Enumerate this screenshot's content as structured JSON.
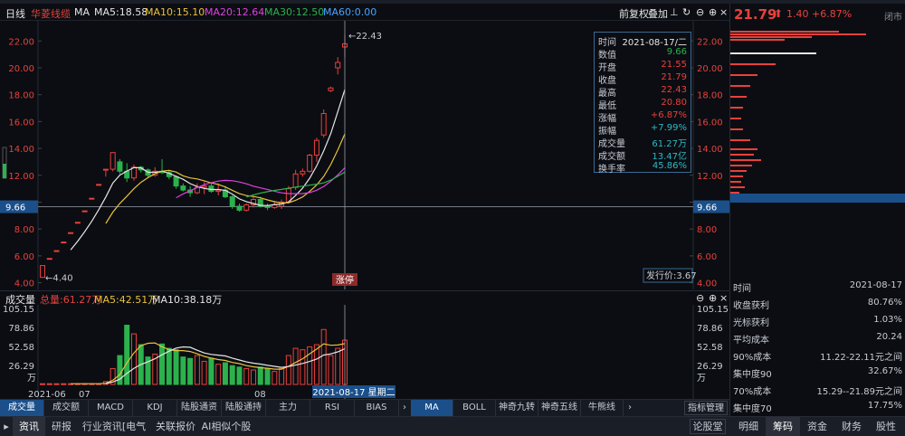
{
  "header": {
    "period": "日线",
    "stock_name": "华菱线缆",
    "ma_label": "MA",
    "ma5": "MA5:18.58",
    "ma10": "MA10:15.10",
    "ma20": "MA20:12.64",
    "ma30": "MA30:12.50",
    "ma60": "MA60:0.00",
    "adjust": "前复权",
    "overlay": "叠加"
  },
  "right_panel": {
    "price": "21.79",
    "change": "1.40",
    "change_pct": "+6.87%",
    "exchange": "闭市"
  },
  "price_axis": [
    "22.00",
    "20.00",
    "18.00",
    "16.00",
    "14.00",
    "12.00",
    "10.00",
    "8.00",
    "6.00",
    "4.00"
  ],
  "current_level": "9.66",
  "annotations": {
    "high": "22.43",
    "low": "4.40",
    "limit_up": "涨停",
    "issue_price": "发行价:3.67"
  },
  "infobox": {
    "rows": [
      {
        "k": "时间",
        "v": "2021-08-17/二"
      },
      {
        "k": "数值",
        "v": "9.66"
      },
      {
        "k": "开盘",
        "v": "21.55"
      },
      {
        "k": "收盘",
        "v": "21.79"
      },
      {
        "k": "最高",
        "v": "22.43"
      },
      {
        "k": "最低",
        "v": "20.80"
      },
      {
        "k": "涨幅",
        "v": "+6.87%"
      },
      {
        "k": "振幅",
        "v": "+7.99%"
      },
      {
        "k": "成交量",
        "v": "61.27万"
      },
      {
        "k": "成交额",
        "v": "13.47亿"
      },
      {
        "k": "换手率",
        "v": "45.86%"
      }
    ]
  },
  "volume": {
    "title": "成交量",
    "total": "总量:61.27万",
    "ma5": "MA5:42.51万",
    "ma10": "MA10:38.18万",
    "axis": [
      "105.15",
      "78.86",
      "52.58",
      "26.29"
    ],
    "unit": "万"
  },
  "date_axis": {
    "labels": [
      "2021-06",
      "07",
      "08"
    ],
    "cursor_date": "2021-08-17 星期二"
  },
  "chart_data": {
    "type": "candlestick",
    "ohlc": [
      {
        "o": 4.4,
        "h": 5.28,
        "l": 4.4,
        "c": 5.28
      },
      {
        "o": 5.81,
        "h": 5.81,
        "l": 5.81,
        "c": 5.81
      },
      {
        "o": 6.39,
        "h": 6.39,
        "l": 6.39,
        "c": 6.39
      },
      {
        "o": 7.03,
        "h": 7.03,
        "l": 7.03,
        "c": 7.03
      },
      {
        "o": 7.73,
        "h": 7.73,
        "l": 7.73,
        "c": 7.73
      },
      {
        "o": 8.5,
        "h": 8.5,
        "l": 8.5,
        "c": 8.5
      },
      {
        "o": 9.35,
        "h": 9.35,
        "l": 9.35,
        "c": 9.35
      },
      {
        "o": 10.29,
        "h": 10.29,
        "l": 10.29,
        "c": 10.29
      },
      {
        "o": 11.32,
        "h": 11.32,
        "l": 11.32,
        "c": 11.32
      },
      {
        "o": 12.45,
        "h": 12.45,
        "l": 11.9,
        "c": 12.45
      },
      {
        "o": 12.45,
        "h": 13.69,
        "l": 12.3,
        "c": 13.69
      },
      {
        "o": 13.0,
        "h": 13.2,
        "l": 12.1,
        "c": 12.3
      },
      {
        "o": 12.3,
        "h": 12.9,
        "l": 11.5,
        "c": 11.8
      },
      {
        "o": 11.8,
        "h": 12.8,
        "l": 11.6,
        "c": 12.6
      },
      {
        "o": 12.6,
        "h": 12.7,
        "l": 12.2,
        "c": 12.4
      },
      {
        "o": 12.4,
        "h": 12.5,
        "l": 11.8,
        "c": 12.0
      },
      {
        "o": 12.0,
        "h": 12.6,
        "l": 11.9,
        "c": 12.3
      },
      {
        "o": 12.3,
        "h": 13.2,
        "l": 12.1,
        "c": 12.2
      },
      {
        "o": 12.2,
        "h": 12.4,
        "l": 11.7,
        "c": 11.9
      },
      {
        "o": 11.9,
        "h": 12.0,
        "l": 11.0,
        "c": 11.2
      },
      {
        "o": 11.2,
        "h": 11.4,
        "l": 10.8,
        "c": 10.9
      },
      {
        "o": 10.9,
        "h": 11.2,
        "l": 10.4,
        "c": 10.7
      },
      {
        "o": 10.7,
        "h": 11.4,
        "l": 10.6,
        "c": 11.1
      },
      {
        "o": 11.1,
        "h": 11.5,
        "l": 10.6,
        "c": 11.2
      },
      {
        "o": 11.2,
        "h": 11.4,
        "l": 10.7,
        "c": 10.8
      },
      {
        "o": 10.8,
        "h": 11.4,
        "l": 10.5,
        "c": 10.9
      },
      {
        "o": 10.9,
        "h": 11.2,
        "l": 10.3,
        "c": 10.4
      },
      {
        "o": 10.4,
        "h": 10.5,
        "l": 9.5,
        "c": 9.7
      },
      {
        "o": 9.7,
        "h": 9.9,
        "l": 9.3,
        "c": 9.4
      },
      {
        "o": 9.4,
        "h": 9.9,
        "l": 9.3,
        "c": 9.8
      },
      {
        "o": 9.8,
        "h": 10.4,
        "l": 9.6,
        "c": 10.2
      },
      {
        "o": 10.2,
        "h": 10.4,
        "l": 9.6,
        "c": 9.7
      },
      {
        "o": 9.7,
        "h": 9.9,
        "l": 9.4,
        "c": 9.6
      },
      {
        "o": 9.6,
        "h": 10.1,
        "l": 9.5,
        "c": 9.8
      },
      {
        "o": 9.7,
        "h": 10.2,
        "l": 9.5,
        "c": 10.0
      },
      {
        "o": 10.0,
        "h": 11.2,
        "l": 9.9,
        "c": 11.0
      },
      {
        "o": 11.1,
        "h": 12.4,
        "l": 10.9,
        "c": 12.1
      },
      {
        "o": 12.1,
        "h": 12.5,
        "l": 11.9,
        "c": 12.3
      },
      {
        "o": 12.3,
        "h": 13.6,
        "l": 12.2,
        "c": 13.5
      },
      {
        "o": 13.5,
        "h": 14.8,
        "l": 13.0,
        "c": 14.6
      },
      {
        "o": 15.0,
        "h": 16.9,
        "l": 14.8,
        "c": 16.6
      },
      {
        "o": 18.3,
        "h": 18.6,
        "l": 18.2,
        "c": 18.5
      },
      {
        "o": 20.0,
        "h": 20.8,
        "l": 19.5,
        "c": 20.4
      },
      {
        "o": 21.55,
        "h": 22.43,
        "l": 20.8,
        "c": 21.79
      }
    ],
    "volume": [
      1,
      1,
      1,
      1,
      1,
      1,
      1,
      1,
      1,
      4,
      22,
      40,
      82,
      70,
      55,
      38,
      42,
      56,
      50,
      48,
      38,
      36,
      40,
      32,
      36,
      28,
      30,
      26,
      24,
      22,
      20,
      24,
      22,
      18,
      22,
      40,
      50,
      48,
      52,
      55,
      76,
      40,
      50,
      61.27
    ],
    "volume_up": [
      true,
      true,
      true,
      true,
      true,
      true,
      true,
      true,
      true,
      true,
      true,
      false,
      false,
      true,
      false,
      false,
      true,
      false,
      false,
      false,
      false,
      false,
      true,
      true,
      false,
      true,
      false,
      false,
      false,
      true,
      true,
      false,
      false,
      true,
      true,
      true,
      true,
      true,
      true,
      true,
      true,
      true,
      true,
      true
    ],
    "ylim": [
      3.5,
      23.5
    ],
    "vol_max": 105.15
  },
  "bottom_tabs": [
    "成交量",
    "成交额",
    "MACD",
    "KDJ",
    "陆股通资金",
    "陆股通持股",
    "主力",
    "RSI",
    "BIAS"
  ],
  "indicator_tabs": [
    "MA",
    "BOLL",
    "神奇九转",
    "神奇五线谱",
    "牛熊线"
  ],
  "indicator_manage": "指标管理",
  "footer_tabs": [
    "资讯",
    "研报",
    "行业资讯[电气设备]",
    "关联报价",
    "AI相似个股"
  ],
  "footer_right": "论股堂",
  "side_stats": {
    "time_label": "时间",
    "time": "2021-08-17",
    "rows": [
      {
        "k": "收盘获利",
        "v": "80.76%"
      },
      {
        "k": "光标获利",
        "v": "1.03%"
      },
      {
        "k": "平均成本",
        "v": "20.24"
      },
      {
        "k": "90%成本",
        "v": "11.22-22.11元之间"
      },
      {
        "k": "集中度90",
        "v": "32.67%"
      },
      {
        "k": "70%成本",
        "v": "15.29--21.89元之间"
      },
      {
        "k": "集中度70",
        "v": "17.75%"
      }
    ]
  },
  "side_tabs": [
    "明细",
    "筹码",
    "资金",
    "财务",
    "股性"
  ]
}
